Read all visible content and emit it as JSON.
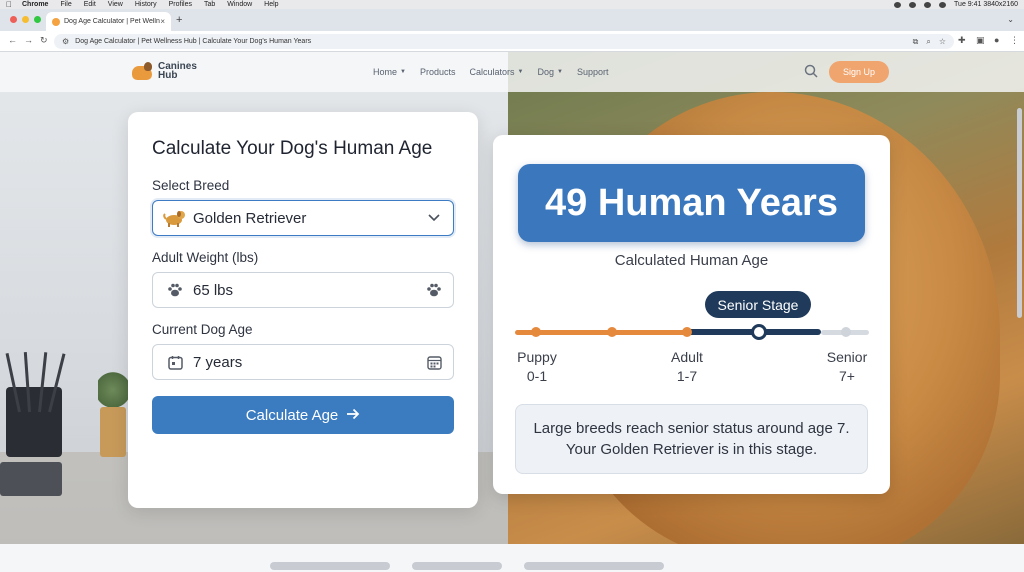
{
  "os_menubar": {
    "app": "Chrome",
    "items": [
      "File",
      "Edit",
      "View",
      "History",
      "Profiles",
      "Tab",
      "Window",
      "Help"
    ],
    "status_right": "Tue 9:41 3840x2160"
  },
  "browser": {
    "tab_title": "Dog Age Calculator | Pet Wellnes",
    "url": "Dog Age Calculator | Pet Wellness Hub | Calculate Your Dog's Human Years"
  },
  "site": {
    "logo_line1": "Canines",
    "logo_line2": "Hub",
    "nav": [
      {
        "label": "Home",
        "has_dropdown": true
      },
      {
        "label": "Products",
        "has_dropdown": false
      },
      {
        "label": "Calculators",
        "has_dropdown": true
      },
      {
        "label": "Dog",
        "has_dropdown": true
      },
      {
        "label": "Support",
        "has_dropdown": false
      }
    ],
    "signup_label": "Sign Up"
  },
  "form": {
    "title": "Calculate Your Dog's Human Age",
    "breed_label": "Select Breed",
    "breed_value": "Golden Retriever",
    "weight_label": "Adult Weight (lbs)",
    "weight_value": "65 lbs",
    "age_label": "Current Dog Age",
    "age_value": "7 years",
    "submit_label": "Calculate Age"
  },
  "result": {
    "value_text": "49 Human Years",
    "caption": "Calculated Human Age",
    "current_stage": "Senior Stage",
    "stages": [
      {
        "name": "Puppy",
        "range": "0-1"
      },
      {
        "name": "Adult",
        "range": "1-7"
      },
      {
        "name": "Senior",
        "range": "7+"
      }
    ],
    "info": "Large breeds reach senior status around age 7. Your Golden Retriever is in this stage."
  },
  "colors": {
    "primary_blue": "#3b7bc0",
    "stage_navy": "#1f3a5a",
    "puppy_adult_orange": "#e5893d",
    "signup_orange": "#f0a46e"
  }
}
